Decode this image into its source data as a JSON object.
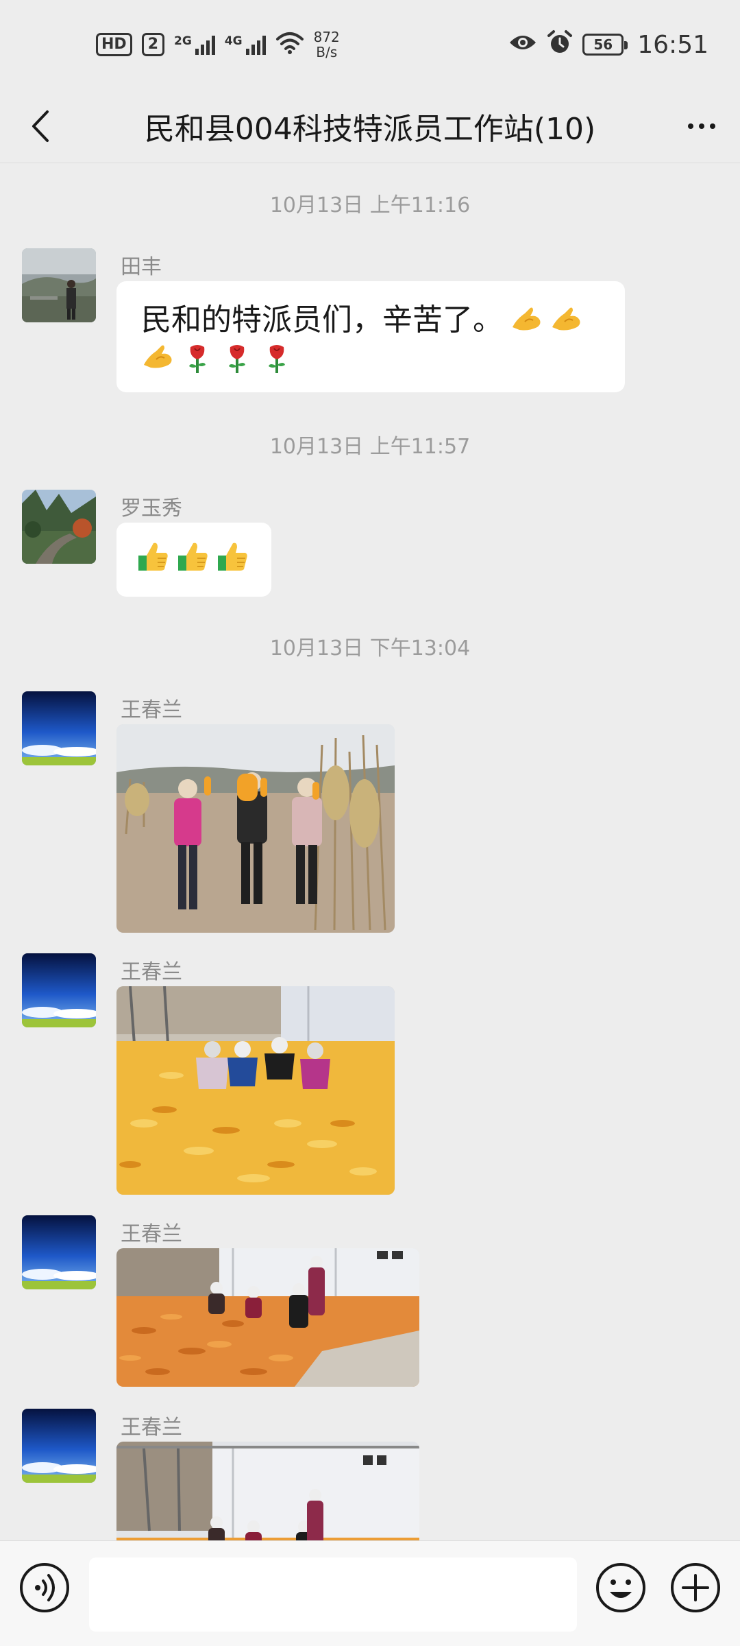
{
  "status_bar": {
    "hd_label": "HD",
    "sim_slot": "2",
    "signal1_label": "2G",
    "signal2_label": "4G",
    "net_speed_value": "872",
    "net_speed_unit": "B/s",
    "battery_level": "56",
    "time": "16:51"
  },
  "header": {
    "title": "民和县004科技特派员工作站(10)"
  },
  "messages": [
    {
      "timestamp": "10月13日 上午11:16",
      "sender": "田丰",
      "text": "民和的特派员们，辛苦了。",
      "emojis": [
        "ok-hand",
        "ok-hand",
        "ok-hand",
        "rose",
        "rose",
        "rose"
      ]
    },
    {
      "timestamp": "10月13日 上午11:57",
      "sender": "罗玉秀",
      "emojis": [
        "thumbs-up",
        "thumbs-up",
        "thumbs-up"
      ]
    },
    {
      "timestamp": "10月13日 下午13:04",
      "sender": "王春兰",
      "photo": "women-holding-corn-in-field"
    },
    {
      "sender": "王春兰",
      "photo": "people-sorting-corn-pile"
    },
    {
      "sender": "王春兰",
      "photo": "people-drying-corn-yard"
    },
    {
      "sender": "王春兰",
      "photo": "people-drying-corn-yard-2"
    }
  ],
  "input_bar": {
    "voice_icon": "voice-icon",
    "emoji_icon": "emoji-icon",
    "plus_icon": "plus-icon",
    "input_value": ""
  },
  "colors": {
    "background": "#ededed",
    "bubble": "#ffffff",
    "meta_text": "#9b9b9b"
  }
}
